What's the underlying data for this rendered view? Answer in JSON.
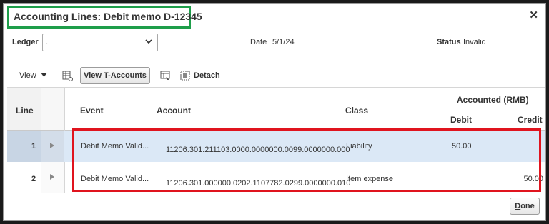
{
  "dialog": {
    "title": "Accounting Lines: Debit memo D-12345",
    "close_glyph": "✕"
  },
  "header": {
    "ledger_label": "Ledger",
    "ledger_value": ".",
    "date_label": "Date",
    "date_value": "5/1/24",
    "status_label": "Status",
    "status_value": "Invalid"
  },
  "toolbar": {
    "view_label": "View",
    "taccounts_label": "View T-Accounts",
    "detach_label": "Detach"
  },
  "table": {
    "headers": {
      "line": "Line",
      "event": "Event",
      "account": "Account",
      "class": "Class",
      "accounted": "Accounted (RMB)",
      "debit": "Debit",
      "credit": "Credit"
    },
    "rows": [
      {
        "line": "1",
        "event": "Debit Memo Valid...",
        "account": "11206.301.211103.0000.0000000.0099.0000000.000",
        "class": "Liability",
        "debit": "50.00",
        "credit": ""
      },
      {
        "line": "2",
        "event": "Debit Memo Valid...",
        "account": "11206.301.000000.0202.1107782.0299.0000000.010",
        "class": "Item expense",
        "debit": "",
        "credit": "50.00"
      }
    ]
  },
  "footer": {
    "done_prefix": "D",
    "done_rest": "one"
  },
  "colors": {
    "title_highlight": "#1e9e4a",
    "rows_highlight": "#e0141e",
    "selected_row": "#dbe8f6"
  }
}
